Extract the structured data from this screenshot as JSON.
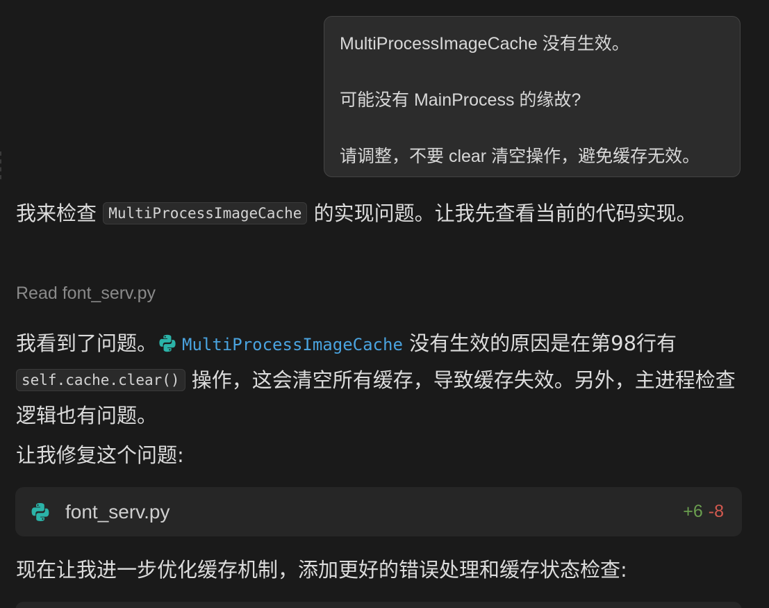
{
  "user_message": {
    "line1": "MultiProcessImageCache 没有生效。",
    "line2": "可能没有 MainProcess 的缘故?",
    "line3": "请调整，不要 clear 清空操作，避免缓存无效。"
  },
  "assistant": {
    "intro_prefix": "我来检查 ",
    "intro_code": "MultiProcessImageCache",
    "intro_suffix": " 的实现问题。让我先查看当前的代码实现。",
    "tool_action": "Read",
    "tool_file": "font_serv.py",
    "analysis_prefix": "我看到了问题。",
    "analysis_symbol": "MultiProcessImageCache",
    "analysis_mid": " 没有生效的原因是在第98行有 ",
    "analysis_code": "self.cache.clear()",
    "analysis_suffix": " 操作，这会清空所有缓存，导致缓存失效。另外，主进程检查逻辑也有问题。",
    "fix_intro": "让我修复这个问题:",
    "file_card": {
      "icon": "python-icon",
      "filename": "font_serv.py",
      "additions": "+6",
      "deletions": "-8"
    },
    "next_step": "现在让我进一步优化缓存机制，添加更好的错误处理和缓存状态检查:"
  },
  "colors": {
    "background": "#1a1a1a",
    "link": "#4aa3df",
    "additions": "#6a9e4f",
    "deletions": "#d3594f",
    "python_icon": "#2bb3a8"
  }
}
